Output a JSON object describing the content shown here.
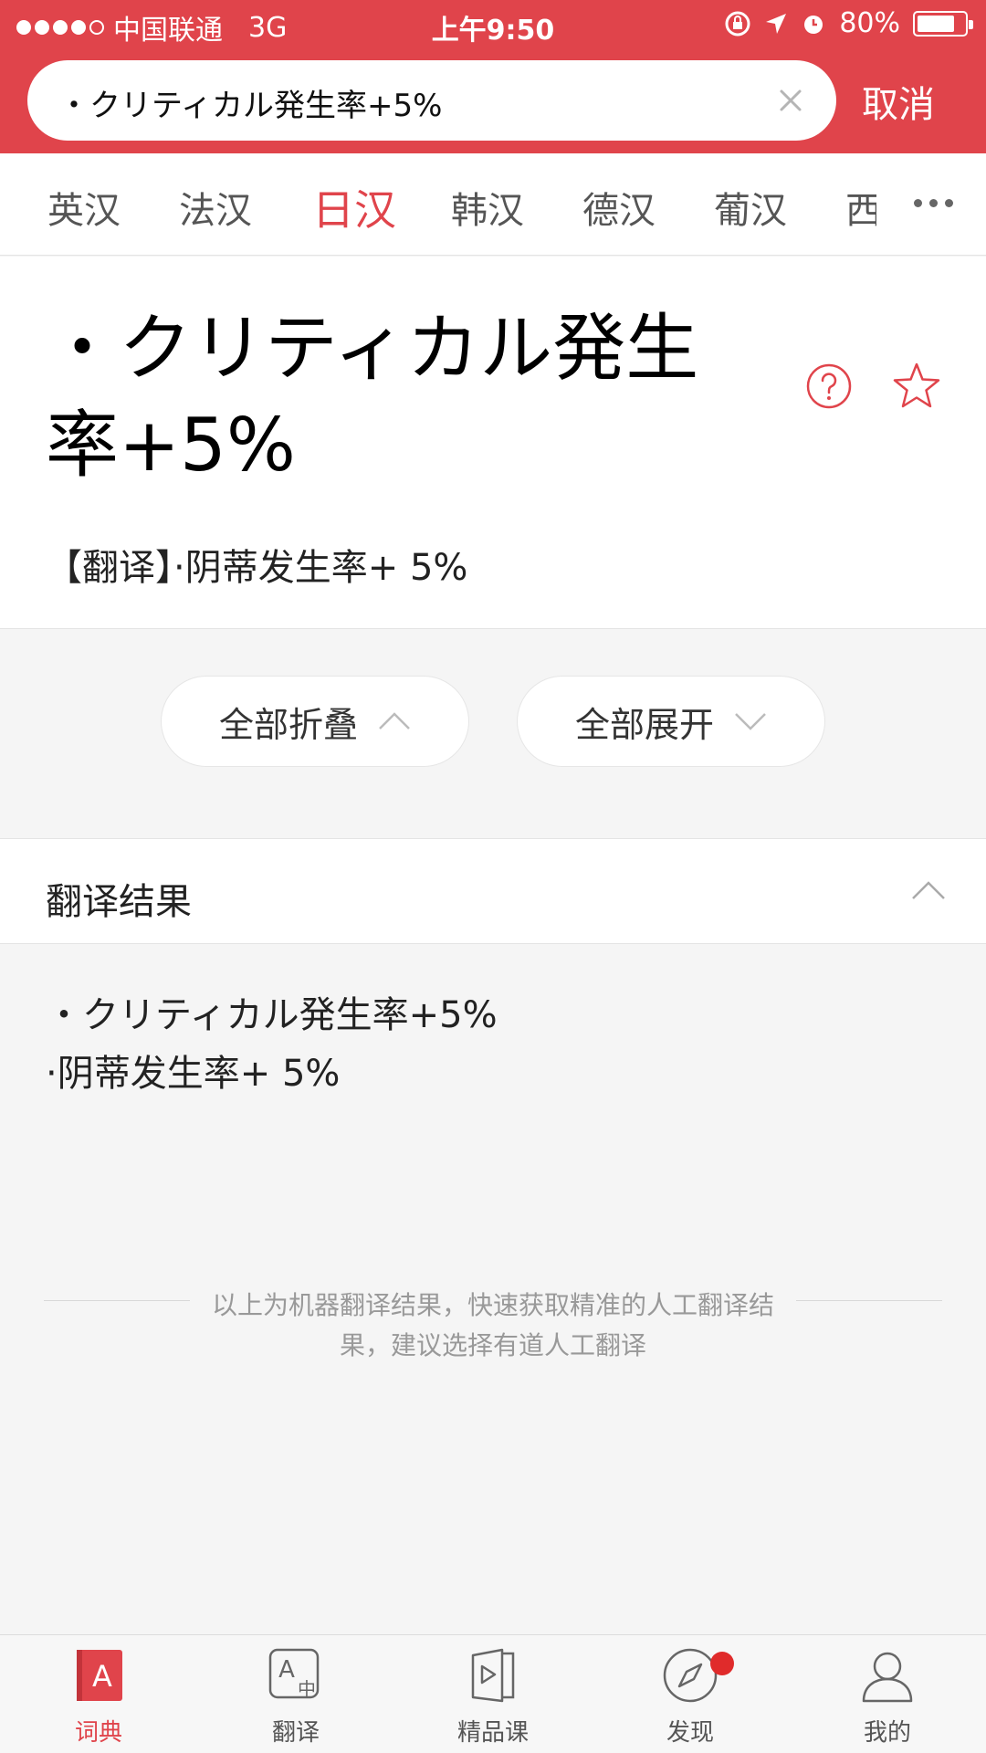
{
  "status_bar": {
    "carrier": "中国联通",
    "network": "3G",
    "time": "上午9:50",
    "battery": "80%",
    "battery_level": 0.8
  },
  "search": {
    "query": "・クリティカル発生率+5%",
    "cancel_label": "取消"
  },
  "lang_tabs": [
    "英汉",
    "法汉",
    "日汉",
    "韩汉",
    "德汉",
    "葡汉",
    "西"
  ],
  "active_tab": "日汉",
  "word": {
    "title": "・クリティカル発生率+5%",
    "translation": "【翻译】·阴蒂发生率+ 5%"
  },
  "actions": {
    "collapse_all": "全部折叠",
    "expand_all": "全部展开"
  },
  "result": {
    "title": "翻译结果",
    "lines": [
      "・クリティカル発生率+5%",
      "·阴蒂发生率+ 5%"
    ],
    "note": "以上为机器翻译结果，快速获取精准的人工翻译结果，建议选择有道人工翻译"
  },
  "bottom_nav": [
    {
      "label": "词典",
      "icon": "dictionary-icon",
      "active": true
    },
    {
      "label": "翻译",
      "icon": "translate-icon",
      "active": false
    },
    {
      "label": "精品课",
      "icon": "course-icon",
      "active": false
    },
    {
      "label": "发现",
      "icon": "compass-icon",
      "active": false,
      "badge": true
    },
    {
      "label": "我的",
      "icon": "profile-icon",
      "active": false
    }
  ],
  "colors": {
    "accent": "#e0444b",
    "badge": "#e02b2b"
  }
}
